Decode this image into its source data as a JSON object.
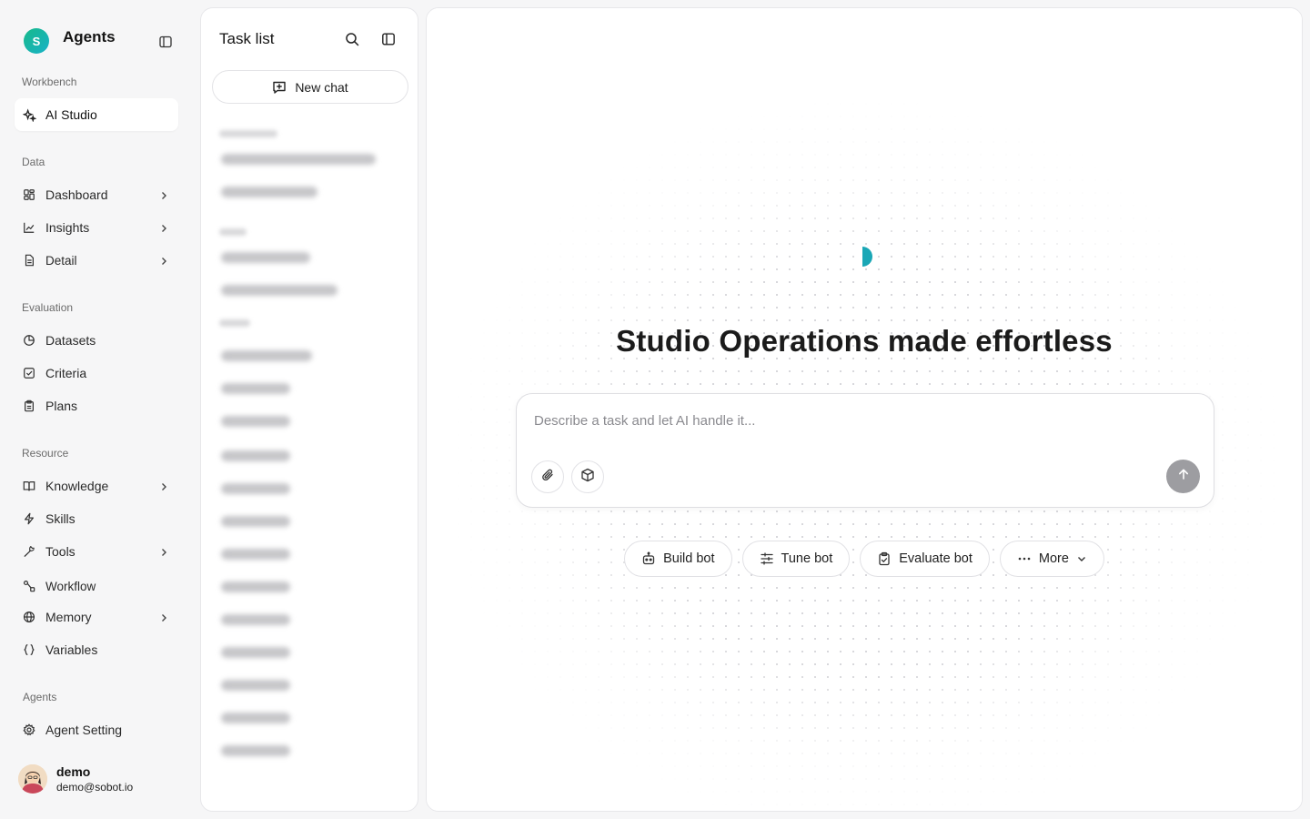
{
  "sidebar": {
    "brand": {
      "logo_letter": "S",
      "name": "Agents"
    },
    "sections": {
      "workbench": "Workbench",
      "data": "Data",
      "evaluation": "Evaluation",
      "resource": "Resource",
      "agents": "Agents"
    },
    "items": {
      "ai_studio": "AI Studio",
      "dashboard": "Dashboard",
      "insights": "Insights",
      "detail": "Detail",
      "datasets": "Datasets",
      "criteria": "Criteria",
      "plans": "Plans",
      "knowledge": "Knowledge",
      "skills": "Skills",
      "tools": "Tools",
      "workflow": "Workflow",
      "memory": "Memory",
      "variables": "Variables",
      "agent_setting": "Agent Setting"
    },
    "active_item": "AI Studio",
    "user": {
      "name": "demo",
      "email": "demo@sobot.io"
    }
  },
  "task_list": {
    "title": "Task list",
    "new_chat_label": "New chat",
    "history_note": "blurred"
  },
  "main": {
    "headline": "Studio Operations made effortless",
    "composer": {
      "placeholder": "Describe a task and let AI handle it..."
    },
    "actions": {
      "build_bot": "Build bot",
      "tune_bot": "Tune bot",
      "evaluate_bot": "Evaluate bot",
      "more": "More"
    }
  },
  "colors": {
    "accent": "#19b2c8",
    "brand_gradient_start": "#17b98a",
    "send_button": "#9d9da1"
  }
}
